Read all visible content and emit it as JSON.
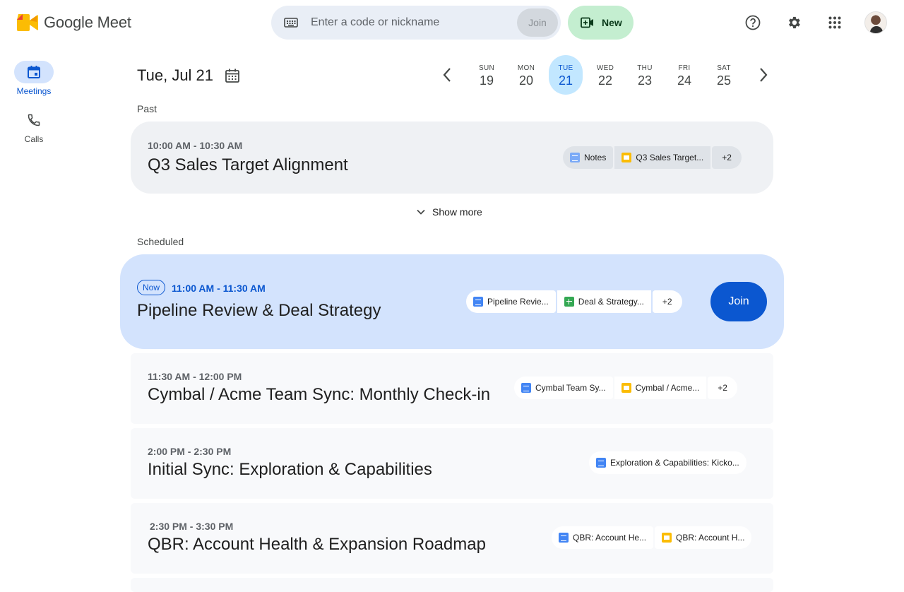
{
  "app": {
    "logo_text": "Google Meet"
  },
  "search": {
    "placeholder": "Enter a code or nickname",
    "join_label": "Join"
  },
  "header": {
    "new_label": "New"
  },
  "rail": {
    "items": [
      {
        "label": "Meetings",
        "icon": "calendar-icon",
        "active": true
      },
      {
        "label": "Calls",
        "icon": "phone-icon"
      }
    ]
  },
  "date": {
    "title": "Tue, Jul 21"
  },
  "week": [
    {
      "name": "SUN",
      "num": "19"
    },
    {
      "name": "MON",
      "num": "20"
    },
    {
      "name": "TUE",
      "num": "21",
      "selected": true
    },
    {
      "name": "WED",
      "num": "22"
    },
    {
      "name": "THU",
      "num": "23"
    },
    {
      "name": "FRI",
      "num": "24"
    },
    {
      "name": "SAT",
      "num": "25"
    }
  ],
  "sections": {
    "past": "Past",
    "scheduled": "Scheduled",
    "show_more": "Show more"
  },
  "past_meeting": {
    "time": "10:00 AM - 10:30 AM",
    "title": "Q3 Sales Target Alignment",
    "chips": [
      {
        "label": "Notes",
        "icon": "notes"
      },
      {
        "label": "Q3 Sales Target...",
        "icon": "slides"
      },
      {
        "label": "+2"
      }
    ]
  },
  "now_meeting": {
    "badge": "Now",
    "time": "11:00 AM - 11:30 AM",
    "title": "Pipeline Review & Deal Strategy",
    "chips": [
      {
        "label": "Pipeline Revie...",
        "icon": "doc"
      },
      {
        "label": "Deal & Strategy...",
        "icon": "sheet"
      },
      {
        "label": "+2"
      }
    ],
    "join_label": "Join"
  },
  "meetings": [
    {
      "time": "11:30 AM - 12:00 PM",
      "title": "Cymbal / Acme Team Sync: Monthly Check-in",
      "chips": [
        {
          "label": "Cymbal Team Sy...",
          "icon": "doc"
        },
        {
          "label": "Cymbal / Acme...",
          "icon": "slides"
        },
        {
          "label": "+2"
        }
      ]
    },
    {
      "time": "2:00 PM - 2:30 PM",
      "title": "Initial Sync: Exploration & Capabilities",
      "chips": [
        {
          "label": "Exploration & Capabilities: Kicko...",
          "icon": "doc"
        }
      ]
    },
    {
      "time": "2:30 PM - 3:30 PM",
      "title": "QBR: Account Health & Expansion Roadmap",
      "chips": [
        {
          "label": "QBR: Account He...",
          "icon": "doc"
        },
        {
          "label": "QBR: Account H...",
          "icon": "slides"
        }
      ]
    }
  ],
  "colors": {
    "accent": "#0b57d0",
    "selected_day": "#c2e7ff",
    "now_card": "#d3e3fd",
    "new_button": "#c4eed0"
  }
}
